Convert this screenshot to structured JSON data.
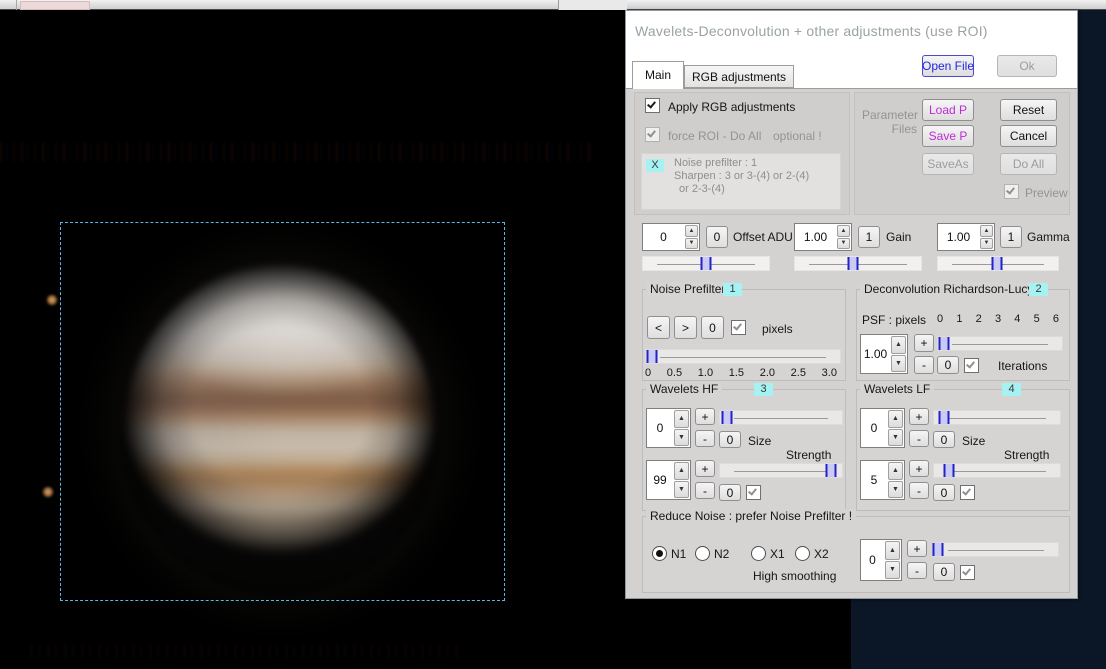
{
  "colors": {
    "app_background_navy": "#0b1726",
    "canvas_black": "#000000",
    "dialog_gray": "#d4d2d0",
    "badge_cyan": "#a6f2f2",
    "open_file_blue": "#2525e4",
    "param_magenta": "#bf2ad6",
    "roi_dash_cyan": "#5cb5e9",
    "slider_thumb_blue": "#2222c8"
  },
  "dlg": {
    "title": "Wavelets-Deconvolution + other adjustments    (use ROI)",
    "tabs": [
      {
        "label": "Main",
        "active": true
      },
      {
        "label": "RGB adjustments",
        "active": false
      }
    ],
    "open_file": "Open File",
    "ok": "Ok",
    "sym": {
      "plus": "+",
      "minus": "-",
      "zero": "0",
      "left": "<",
      "right": ">"
    },
    "options": {
      "apply_rgb": "Apply RGB adjustments",
      "force_roi": "force ROI - Do All",
      "optional": "optional !",
      "hint_badge": "X",
      "hint_line1": "Noise prefilter :  1",
      "hint_line2": "Sharpen :   3  or  3-(4)  or  2-(4)",
      "hint_line3": "or  2-3-(4)"
    },
    "parameter_files": {
      "line1": "Parameter",
      "line2": "Files",
      "load": "Load P",
      "save": "Save P",
      "save_as": "SaveAs"
    },
    "actions": {
      "reset": "Reset",
      "cancel": "Cancel",
      "do_all": "Do All",
      "preview": "Preview"
    },
    "adjusters": [
      {
        "value": "0",
        "reset": "0",
        "label": "Offset ADU",
        "slider": 50
      },
      {
        "value": "1.00",
        "reset": "1",
        "label": "Gain",
        "slider": 46
      },
      {
        "value": "1.00",
        "reset": "1",
        "label": "Gamma",
        "slider": 49
      }
    ],
    "noise_prefilter": {
      "title": "Noise Prefilter",
      "badge": "1",
      "pixels": "pixels",
      "scale": [
        "0",
        "0.5",
        "1.0",
        "1.5",
        "2.0",
        "2.5",
        "3.0"
      ],
      "slider": 3
    },
    "deconvolution": {
      "title": "Deconvolution Richardson-Lucy",
      "badge": "2",
      "psf_label": "PSF : pixels",
      "scale": [
        "0",
        "1",
        "2",
        "3",
        "4",
        "5",
        "6"
      ],
      "value": "1.00",
      "iterations": "Iterations",
      "slider": 5
    },
    "wavelets_hf": {
      "title": "Wavelets HF",
      "badge": "3",
      "size": "Size",
      "strength": "Strength",
      "row1_value": "0",
      "row1_slider": 6,
      "row2_value": "99",
      "row2_slider": 91
    },
    "wavelets_lf": {
      "title": "Wavelets LF",
      "badge": "4",
      "size": "Size",
      "strength": "Strength",
      "row1_value": "0",
      "row1_slider": 8,
      "row2_value": "5",
      "row2_slider": 12
    },
    "reduce_noise": {
      "title": "Reduce Noise :  prefer Noise Prefilter !",
      "radios": [
        {
          "label": "N1",
          "selected": true
        },
        {
          "label": "N2",
          "selected": false
        },
        {
          "label": "X1",
          "selected": false
        },
        {
          "label": "X2",
          "selected": false
        }
      ],
      "high_smoothing": "High smoothing",
      "value": "0",
      "slider": 3
    }
  }
}
